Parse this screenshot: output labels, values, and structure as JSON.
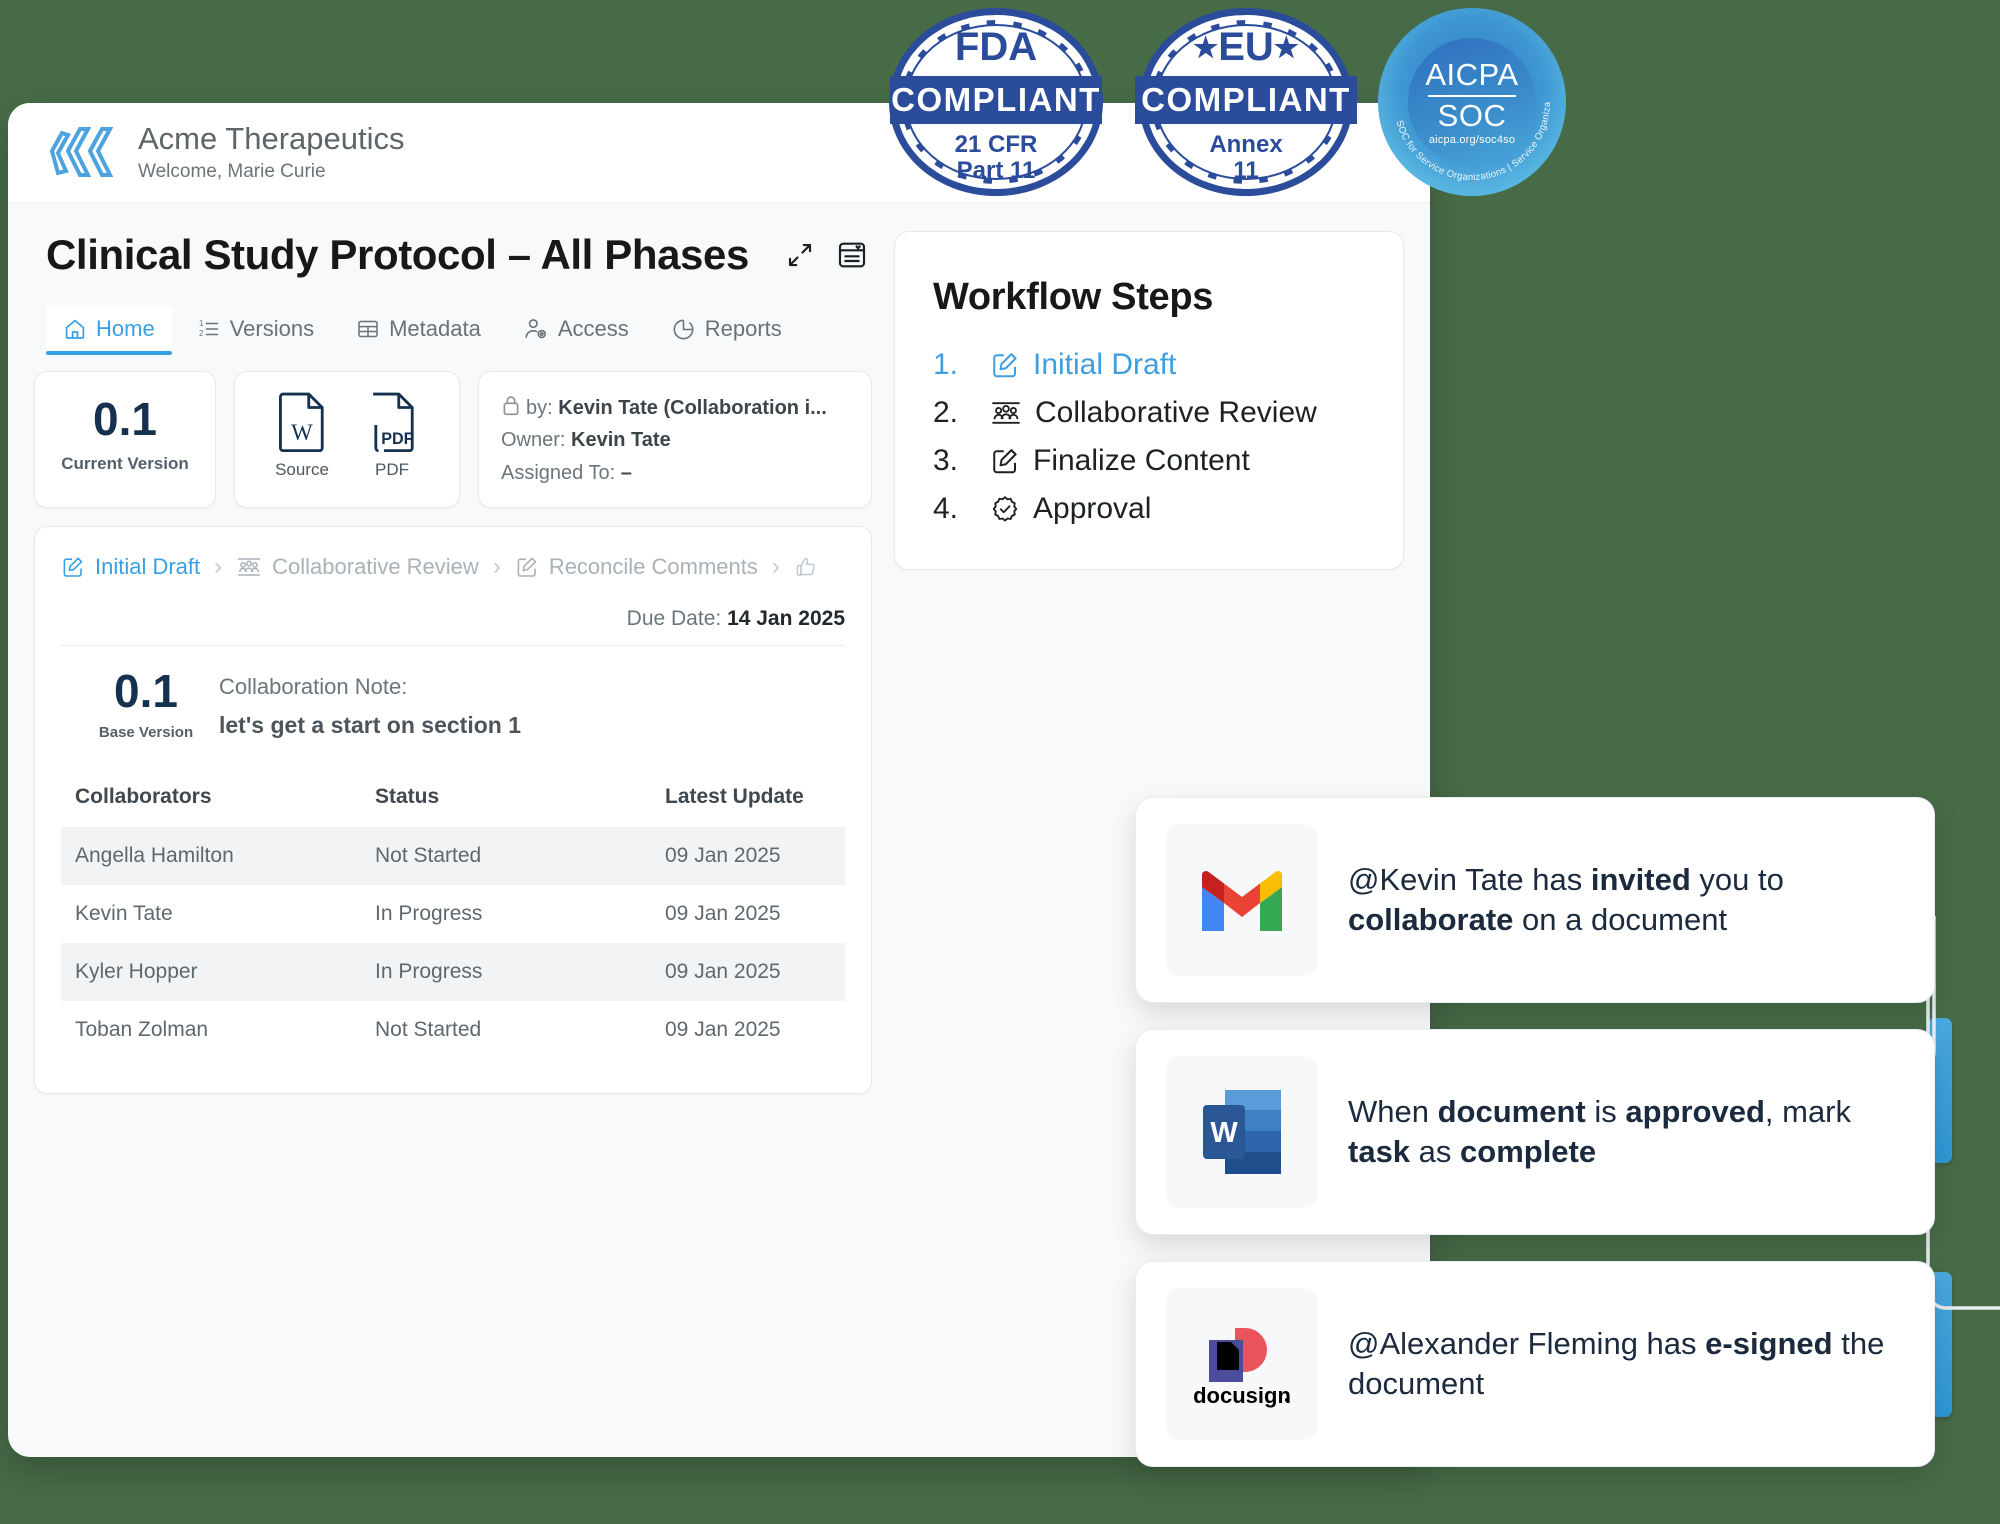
{
  "badges": [
    {
      "id": "fda",
      "top": "FDA",
      "band": "COMPLIANT",
      "bottom": "21 CFR\nPart 11"
    },
    {
      "id": "eu",
      "top": "★EU★",
      "band": "COMPLIANT",
      "bottom": "Annex\n11"
    }
  ],
  "soc_badge": {
    "line1": "AICPA",
    "line2": "SOC",
    "url": "aicpa.org/soc4so",
    "arc_text": "SOC for Service Organizations | Service Organizations"
  },
  "brand": {
    "name": "Acme Therapeutics",
    "welcome": "Welcome, Marie Curie",
    "logo_icon": "acme-chevron-logo"
  },
  "document": {
    "title": "Clinical Study Protocol – All Phases",
    "actions": [
      {
        "name": "expand-icon",
        "label": "Expand"
      },
      {
        "name": "document-panel-icon",
        "label": "Panels"
      }
    ]
  },
  "tabs": [
    {
      "label": "Home",
      "icon": "home-icon",
      "active": true
    },
    {
      "label": "Versions",
      "icon": "list-ordered-icon",
      "active": false
    },
    {
      "label": "Metadata",
      "icon": "table-icon",
      "active": false
    },
    {
      "label": "Access",
      "icon": "user-gear-icon",
      "active": false
    },
    {
      "label": "Reports",
      "icon": "pie-chart-icon",
      "active": false
    }
  ],
  "version_card": {
    "value": "0.1",
    "label": "Current Version"
  },
  "files_card": [
    {
      "label": "Source",
      "icon": "word-file-icon"
    },
    {
      "label": "PDF",
      "icon": "pdf-file-icon"
    }
  ],
  "meta_card": {
    "locked_by_label": "by:",
    "locked_by_value": "Kevin Tate (Collaboration i...",
    "owner_label": "Owner:",
    "owner_value": "Kevin Tate",
    "assigned_label": "Assigned To:",
    "assigned_value": "–",
    "lock_icon": "lock-icon"
  },
  "breadcrumbs": [
    {
      "label": "Initial Draft",
      "icon": "edit-square-icon",
      "active": true
    },
    {
      "label": "Collaborative Review",
      "icon": "group-people-icon",
      "active": false
    },
    {
      "label": "Reconcile Comments",
      "icon": "edit-square-icon",
      "active": false
    },
    {
      "label": "",
      "icon": "thumbs-up-icon",
      "active": false
    }
  ],
  "due": {
    "label": "Due Date:",
    "value": "14 Jan 2025"
  },
  "note": {
    "version": "0.1",
    "version_label": "Base Version",
    "title": "Collaboration Note:",
    "text": "let's get a start on section 1"
  },
  "collaborators_table": {
    "headers": [
      "Collaborators",
      "Status",
      "Latest Update"
    ],
    "rows": [
      [
        "Angella Hamilton",
        "Not Started",
        "09 Jan 2025"
      ],
      [
        "Kevin Tate",
        "In Progress",
        "09 Jan 2025"
      ],
      [
        "Kyler Hopper",
        "In Progress",
        "09 Jan 2025"
      ],
      [
        "Toban Zolman",
        "Not Started",
        "09 Jan 2025"
      ]
    ]
  },
  "workflow": {
    "title": "Workflow Steps",
    "steps": [
      {
        "num": "1.",
        "label": "Initial Draft",
        "icon": "edit-square-icon",
        "active": true
      },
      {
        "num": "2.",
        "label": "Collaborative Review",
        "icon": "group-people-icon",
        "active": false
      },
      {
        "num": "3.",
        "label": "Finalize Content",
        "icon": "edit-square-icon",
        "active": false
      },
      {
        "num": "4.",
        "label": "Approval",
        "icon": "check-badge-icon",
        "active": false
      }
    ]
  },
  "notifications": [
    {
      "icon": "gmail-icon",
      "parts": [
        {
          "t": "@Kevin Tate has ",
          "b": false
        },
        {
          "t": "invited",
          "b": true
        },
        {
          "t": " you to ",
          "b": false
        },
        {
          "t": "collaborate",
          "b": true
        },
        {
          "t": " on a document",
          "b": false
        }
      ]
    },
    {
      "icon": "word-icon",
      "parts": [
        {
          "t": "When ",
          "b": false
        },
        {
          "t": "document",
          "b": true
        },
        {
          "t": " is ",
          "b": false
        },
        {
          "t": "approved",
          "b": true
        },
        {
          "t": ", mark ",
          "b": false
        },
        {
          "t": "task",
          "b": true
        },
        {
          "t": " as ",
          "b": false
        },
        {
          "t": "complete",
          "b": true
        }
      ]
    },
    {
      "icon": "docusign-icon",
      "parts": [
        {
          "t": "@Alexander Fleming has ",
          "b": false
        },
        {
          "t": "e-signed",
          "b": true
        },
        {
          "t": " the document",
          "b": false
        }
      ]
    }
  ],
  "colors": {
    "page_bg": "#476b47",
    "accent": "#37a0e4",
    "badge_blue": "#2b4b9b",
    "dark_navy": "#16314f"
  }
}
